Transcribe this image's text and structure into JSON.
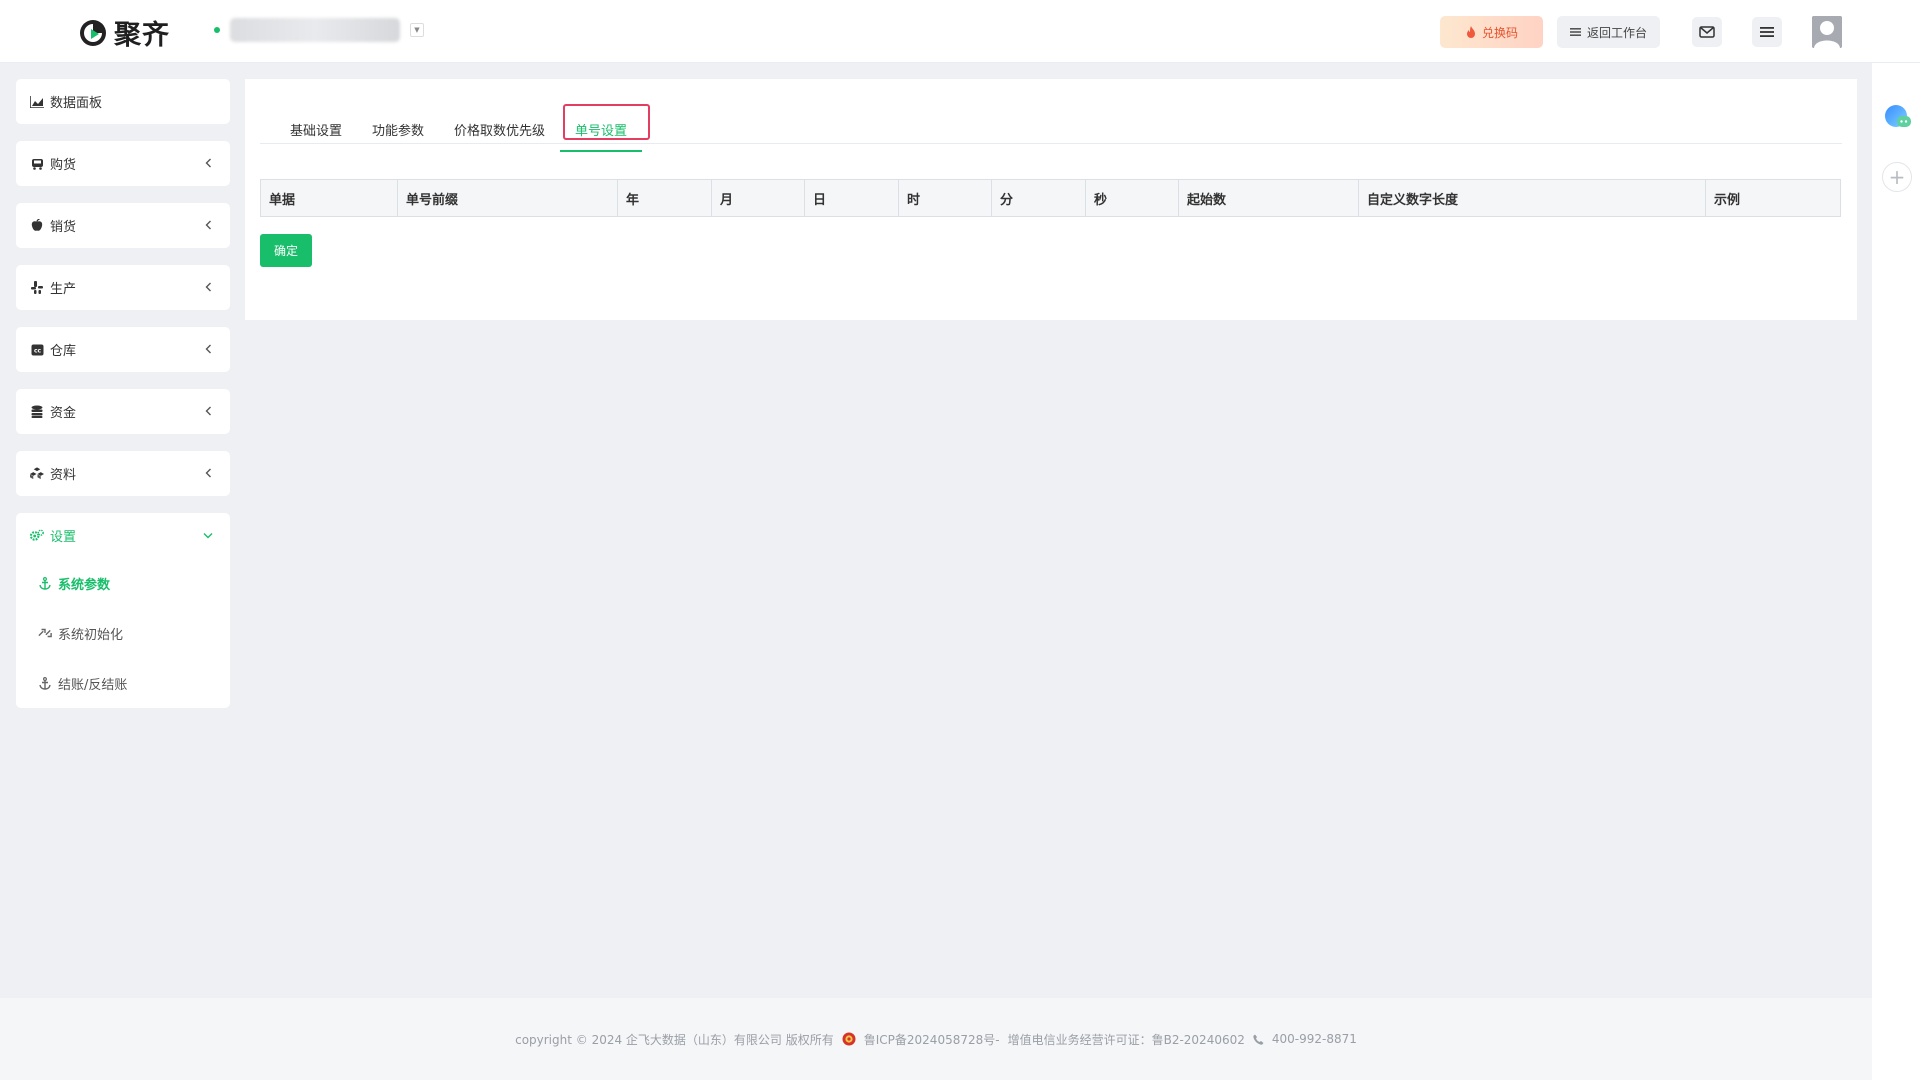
{
  "header": {
    "brand": "聚齐",
    "redeem_label": "兑换码",
    "back_label": "返回工作台",
    "mail_icon": "mail-icon",
    "menu_icon": "menu-icon",
    "avatar_icon": "user-avatar-icon"
  },
  "sidebar": {
    "items": [
      {
        "label": "数据面板",
        "icon": "area-chart-icon",
        "has_chevron": false
      },
      {
        "label": "购货",
        "icon": "bus-icon",
        "has_chevron": true
      },
      {
        "label": "销货",
        "icon": "apple-icon",
        "has_chevron": true
      },
      {
        "label": "生产",
        "icon": "yelp-icon",
        "has_chevron": true
      },
      {
        "label": "仓库",
        "icon": "cc-icon",
        "has_chevron": true
      },
      {
        "label": "资金",
        "icon": "database-icon",
        "has_chevron": true
      },
      {
        "label": "资料",
        "icon": "cubes-icon",
        "has_chevron": true
      }
    ],
    "settings": {
      "label": "设置",
      "icon": "cogs-icon",
      "children": [
        {
          "label": "系统参数",
          "icon": "anchor-icon",
          "active": true
        },
        {
          "label": "系统初始化",
          "icon": "wrench-icon",
          "active": false
        },
        {
          "label": "结账/反结账",
          "icon": "anchor-icon",
          "active": false
        }
      ]
    }
  },
  "main": {
    "tabs": [
      {
        "label": "基础设置",
        "active": false
      },
      {
        "label": "功能参数",
        "active": false
      },
      {
        "label": "价格取数优先级",
        "active": false
      },
      {
        "label": "单号设置",
        "active": true
      }
    ],
    "table": {
      "columns": [
        "单据",
        "单号前缀",
        "年",
        "月",
        "日",
        "时",
        "分",
        "秒",
        "起始数",
        "自定义数字长度",
        "示例"
      ],
      "rows": []
    },
    "confirm_label": "确定"
  },
  "footer": {
    "copyright": "copyright © 2024 企飞大数据（山东）有限公司 版权所有",
    "icp": "鲁ICP备2024058728号-",
    "license": "增值电信业务经营许可证：鲁B2-20240602",
    "phone": "400-992-8871"
  },
  "colors": {
    "accent": "#19be6b",
    "highlight_border": "#e33d61",
    "redeem_text": "#e5522d"
  }
}
